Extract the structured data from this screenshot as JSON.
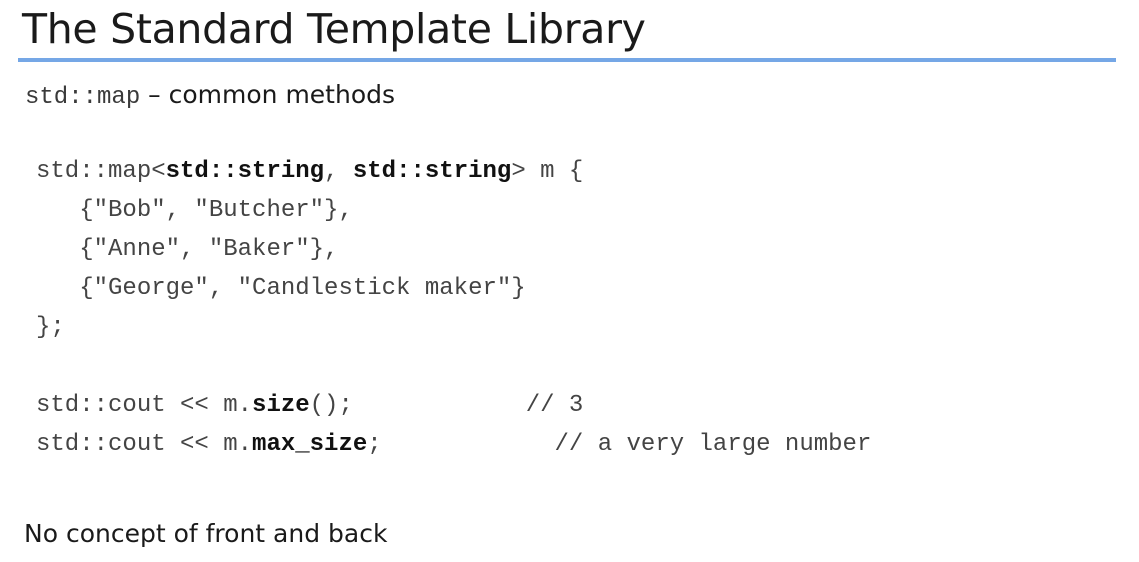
{
  "slide": {
    "title": "The Standard Template Library",
    "subtitle_code": "std::map",
    "subtitle_text": " – common methods",
    "code": {
      "l1_a": "std::map<",
      "l1_b": "std::string",
      "l1_c": ", ",
      "l1_d": "std::string",
      "l1_e": "> m {",
      "l2": "   {\"Bob\", \"Butcher\"},",
      "l3": "   {\"Anne\", \"Baker\"},",
      "l4": "   {\"George\", \"Candlestick maker\"}",
      "l5": "};",
      "l7_a": "std::cout << m.",
      "l7_b": "size",
      "l7_c": "();            // 3",
      "l8_a": "std::cout << m.",
      "l8_b": "max_size",
      "l8_c": ";            // a very large number"
    },
    "footer_note": "No concept of front and back",
    "colors": {
      "accent_rule": "#75a7e6"
    }
  }
}
